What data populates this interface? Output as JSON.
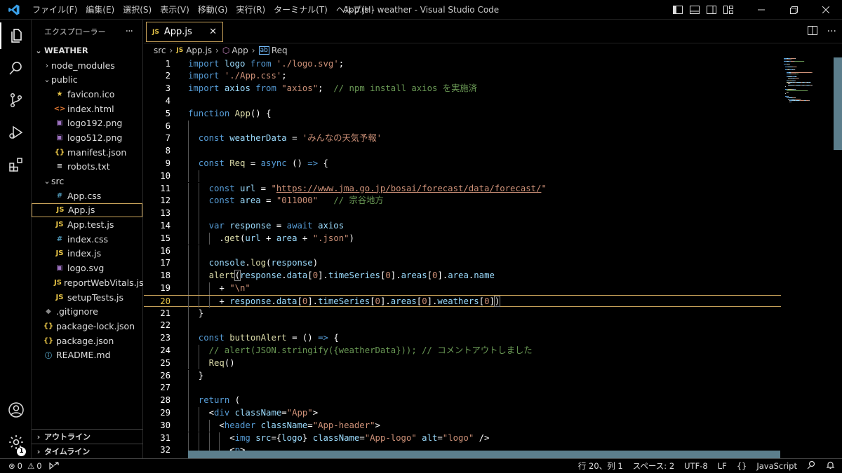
{
  "window": {
    "title": "App.js - weather - Visual Studio Code",
    "menu": [
      "ファイル(F)",
      "編集(E)",
      "選択(S)",
      "表示(V)",
      "移動(G)",
      "実行(R)",
      "ターミナル(T)",
      "ヘルプ(H)"
    ]
  },
  "activity_bar": {
    "items": [
      "files-icon",
      "search-icon",
      "source-control-icon",
      "run-debug-icon",
      "extensions-icon"
    ],
    "bottom": [
      "account-icon",
      "manage-gear-icon"
    ],
    "gear_badge": "1"
  },
  "sidebar": {
    "title": "エクスプローラー",
    "more": "···",
    "root": "WEATHER",
    "tree": [
      {
        "label": "node_modules",
        "kind": "folder",
        "open": false,
        "depth": 1
      },
      {
        "label": "public",
        "kind": "folder",
        "open": true,
        "depth": 1
      },
      {
        "label": "favicon.ico",
        "kind": "ico",
        "depth": 2
      },
      {
        "label": "index.html",
        "kind": "html",
        "depth": 2
      },
      {
        "label": "logo192.png",
        "kind": "img",
        "depth": 2
      },
      {
        "label": "logo512.png",
        "kind": "img",
        "depth": 2
      },
      {
        "label": "manifest.json",
        "kind": "json",
        "depth": 2
      },
      {
        "label": "robots.txt",
        "kind": "txt",
        "depth": 2
      },
      {
        "label": "src",
        "kind": "folder",
        "open": true,
        "depth": 1
      },
      {
        "label": "App.css",
        "kind": "css",
        "depth": 2
      },
      {
        "label": "App.js",
        "kind": "js",
        "depth": 2,
        "selected": true
      },
      {
        "label": "App.test.js",
        "kind": "js",
        "depth": 2
      },
      {
        "label": "index.css",
        "kind": "css",
        "depth": 2
      },
      {
        "label": "index.js",
        "kind": "js",
        "depth": 2
      },
      {
        "label": "logo.svg",
        "kind": "svg",
        "depth": 2
      },
      {
        "label": "reportWebVitals.js",
        "kind": "js",
        "depth": 2
      },
      {
        "label": "setupTests.js",
        "kind": "js",
        "depth": 2
      },
      {
        "label": ".gitignore",
        "kind": "git",
        "depth": 1
      },
      {
        "label": "package-lock.json",
        "kind": "json",
        "depth": 1
      },
      {
        "label": "package.json",
        "kind": "json",
        "depth": 1
      },
      {
        "label": "README.md",
        "kind": "md",
        "depth": 1
      }
    ],
    "outline_label": "アウトライン",
    "timeline_label": "タイムライン"
  },
  "editor": {
    "tab_label": "App.js",
    "tab_badge": "JS",
    "tab_close": "✕",
    "breadcrumb": [
      "src",
      "App.js",
      "App",
      "Req"
    ],
    "current_line": 20,
    "lines": [
      {
        "n": 1,
        "indent": 0,
        "tokens": [
          [
            "kw",
            "import "
          ],
          [
            "var",
            "logo "
          ],
          [
            "kw",
            "from "
          ],
          [
            "str",
            "'./logo.svg'"
          ],
          [
            "",
            "; "
          ]
        ]
      },
      {
        "n": 2,
        "indent": 0,
        "tokens": [
          [
            "kw",
            "import "
          ],
          [
            "str",
            "'./App.css'"
          ],
          [
            "",
            ";"
          ]
        ]
      },
      {
        "n": 3,
        "indent": 0,
        "tokens": [
          [
            "kw",
            "import "
          ],
          [
            "var",
            "axios "
          ],
          [
            "kw",
            "from "
          ],
          [
            "str",
            "\"axios\""
          ],
          [
            "",
            ";  "
          ],
          [
            "cm",
            "// npm install axios を実施済"
          ]
        ]
      },
      {
        "n": 4,
        "indent": 0,
        "tokens": []
      },
      {
        "n": 5,
        "indent": 0,
        "tokens": [
          [
            "kw",
            "function "
          ],
          [
            "fn",
            "App"
          ],
          [
            "",
            "() {"
          ]
        ]
      },
      {
        "n": 6,
        "indent": 1,
        "tokens": []
      },
      {
        "n": 7,
        "indent": 1,
        "tokens": [
          [
            "kw",
            "const "
          ],
          [
            "var",
            "weatherData "
          ],
          [
            "",
            "= "
          ],
          [
            "str",
            "'みんなの天気予報'"
          ]
        ]
      },
      {
        "n": 8,
        "indent": 1,
        "tokens": []
      },
      {
        "n": 9,
        "indent": 1,
        "tokens": [
          [
            "kw",
            "const "
          ],
          [
            "fn",
            "Req "
          ],
          [
            "",
            "= "
          ],
          [
            "kw",
            "async "
          ],
          [
            "",
            "() "
          ],
          [
            "kw",
            "=> "
          ],
          [
            "",
            "{"
          ]
        ]
      },
      {
        "n": 10,
        "indent": 2,
        "tokens": []
      },
      {
        "n": 11,
        "indent": 2,
        "tokens": [
          [
            "kw",
            "const "
          ],
          [
            "var",
            "url "
          ],
          [
            "",
            "= "
          ],
          [
            "str",
            "\""
          ],
          [
            "url",
            "https://www.jma.go.jp/bosai/forecast/data/forecast/"
          ],
          [
            "str",
            "\""
          ]
        ]
      },
      {
        "n": 12,
        "indent": 2,
        "tokens": [
          [
            "kw",
            "const "
          ],
          [
            "var",
            "area "
          ],
          [
            "",
            "= "
          ],
          [
            "str",
            "\"011000\""
          ],
          [
            "",
            "   "
          ],
          [
            "cm",
            "// 宗谷地方"
          ]
        ]
      },
      {
        "n": 13,
        "indent": 2,
        "tokens": []
      },
      {
        "n": 14,
        "indent": 2,
        "tokens": [
          [
            "kw",
            "var "
          ],
          [
            "var",
            "response "
          ],
          [
            "",
            "= "
          ],
          [
            "kw",
            "await "
          ],
          [
            "var",
            "axios"
          ]
        ]
      },
      {
        "n": 15,
        "indent": 3,
        "tokens": [
          [
            "",
            "."
          ],
          [
            "fn",
            "get"
          ],
          [
            "",
            "("
          ],
          [
            "var",
            "url "
          ],
          [
            "",
            "+ "
          ],
          [
            "var",
            "area "
          ],
          [
            "",
            "+ "
          ],
          [
            "str",
            "\".json\""
          ],
          [
            "",
            ")"
          ]
        ]
      },
      {
        "n": 16,
        "indent": 2,
        "tokens": []
      },
      {
        "n": 17,
        "indent": 2,
        "tokens": [
          [
            "var",
            "console"
          ],
          [
            "",
            "."
          ],
          [
            "fn",
            "log"
          ],
          [
            "",
            "("
          ],
          [
            "var",
            "response"
          ],
          [
            "",
            ")"
          ]
        ]
      },
      {
        "n": 18,
        "indent": 2,
        "tokens": [
          [
            "fn",
            "alert"
          ],
          [
            "bracket",
            "("
          ],
          [
            "var",
            "response"
          ],
          [
            "",
            "."
          ],
          [
            "var",
            "data"
          ],
          [
            "",
            "["
          ],
          [
            "str",
            "0"
          ],
          [
            "",
            "]."
          ],
          [
            "var",
            "timeSeries"
          ],
          [
            "",
            "["
          ],
          [
            "str",
            "0"
          ],
          [
            "",
            "]."
          ],
          [
            "var",
            "areas"
          ],
          [
            "",
            "["
          ],
          [
            "str",
            "0"
          ],
          [
            "",
            "]."
          ],
          [
            "var",
            "area"
          ],
          [
            "",
            "."
          ],
          [
            "var",
            "name"
          ]
        ]
      },
      {
        "n": 19,
        "indent": 3,
        "tokens": [
          [
            "",
            "+ "
          ],
          [
            "str",
            "\"\\n\""
          ]
        ]
      },
      {
        "n": 20,
        "indent": 3,
        "tokens": [
          [
            "",
            "+ "
          ],
          [
            "var",
            "response"
          ],
          [
            "",
            "."
          ],
          [
            "var",
            "data"
          ],
          [
            "",
            "["
          ],
          [
            "str",
            "0"
          ],
          [
            "",
            "]."
          ],
          [
            "var",
            "timeSeries"
          ],
          [
            "",
            "["
          ],
          [
            "str",
            "0"
          ],
          [
            "",
            "]."
          ],
          [
            "var",
            "areas"
          ],
          [
            "",
            "["
          ],
          [
            "str",
            "0"
          ],
          [
            "",
            "]."
          ],
          [
            "var",
            "weathers"
          ],
          [
            "",
            "["
          ],
          [
            "str",
            "0"
          ],
          [
            "",
            "]"
          ],
          [
            "bracket",
            ")"
          ]
        ]
      },
      {
        "n": 21,
        "indent": 1,
        "tokens": [
          [
            "",
            "}"
          ]
        ]
      },
      {
        "n": 22,
        "indent": 1,
        "tokens": []
      },
      {
        "n": 23,
        "indent": 1,
        "tokens": [
          [
            "kw",
            "const "
          ],
          [
            "fn",
            "buttonAlert "
          ],
          [
            "",
            "= () "
          ],
          [
            "kw",
            "=> "
          ],
          [
            "",
            "{"
          ]
        ]
      },
      {
        "n": 24,
        "indent": 2,
        "tokens": [
          [
            "cm",
            "// alert(JSON.stringify({weatherData})); // コメントアウトしました"
          ]
        ]
      },
      {
        "n": 25,
        "indent": 2,
        "tokens": [
          [
            "fn",
            "Req"
          ],
          [
            "",
            "()"
          ]
        ]
      },
      {
        "n": 26,
        "indent": 1,
        "tokens": [
          [
            "",
            "}"
          ]
        ]
      },
      {
        "n": 27,
        "indent": 1,
        "tokens": []
      },
      {
        "n": 28,
        "indent": 1,
        "tokens": [
          [
            "kw",
            "return "
          ],
          [
            "",
            "("
          ]
        ]
      },
      {
        "n": 29,
        "indent": 2,
        "tokens": [
          [
            "",
            "<"
          ],
          [
            "tag",
            "div "
          ],
          [
            "attr",
            "className"
          ],
          [
            "",
            "="
          ],
          [
            "str",
            "\"App\""
          ],
          [
            "",
            ">"
          ]
        ]
      },
      {
        "n": 30,
        "indent": 3,
        "tokens": [
          [
            "",
            "<"
          ],
          [
            "tag",
            "header "
          ],
          [
            "attr",
            "className"
          ],
          [
            "",
            "="
          ],
          [
            "str",
            "\"App-header\""
          ],
          [
            "",
            ">"
          ]
        ]
      },
      {
        "n": 31,
        "indent": 4,
        "tokens": [
          [
            "",
            "<"
          ],
          [
            "tag",
            "img "
          ],
          [
            "attr",
            "src"
          ],
          [
            "",
            "={"
          ],
          [
            "var",
            "logo"
          ],
          [
            "",
            "} "
          ],
          [
            "attr",
            "className"
          ],
          [
            "",
            "="
          ],
          [
            "str",
            "\"App-logo\" "
          ],
          [
            "attr",
            "alt"
          ],
          [
            "",
            "="
          ],
          [
            "str",
            "\"logo\" "
          ],
          [
            "",
            "/>"
          ]
        ]
      },
      {
        "n": 32,
        "indent": 4,
        "tokens": [
          [
            "",
            "<"
          ],
          [
            "tag",
            "p"
          ],
          [
            "",
            ">"
          ]
        ]
      }
    ]
  },
  "status_bar": {
    "errors": "0",
    "warnings": "0",
    "position": "行 20、列 1",
    "spaces": "スペース: 2",
    "encoding": "UTF-8",
    "eol": "LF",
    "braces": "{}",
    "language": "JavaScript"
  },
  "colors": {
    "accent_border": "#c8a25a",
    "keyword": "#569cd6",
    "function": "#dcdcaa",
    "variable": "#9cdcfe",
    "string": "#ce9178",
    "comment": "#6a9955",
    "scrollbar": "#5c7e8c"
  }
}
